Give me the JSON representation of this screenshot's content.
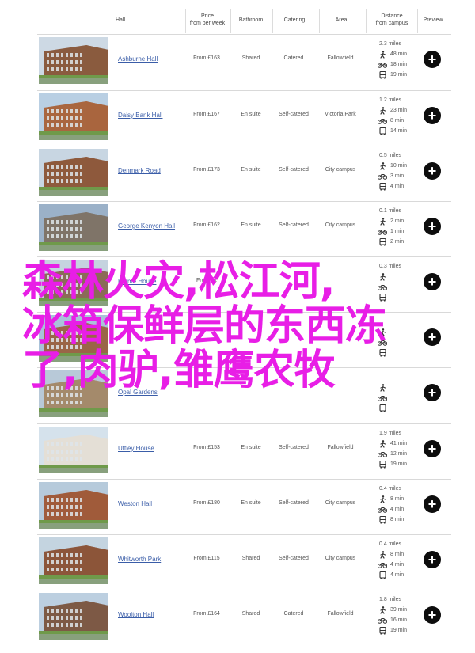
{
  "header": {
    "hall": "Hall",
    "price": "Price\nfrom per week",
    "bathroom": "Bathroom",
    "catering": "Catering",
    "area": "Area",
    "distance": "Distance\nfrom campus",
    "preview": "Preview"
  },
  "icons": {
    "walk": "walking-person-icon",
    "bike": "bicycle-icon",
    "bus": "bus-icon",
    "preview": "plus-circle-icon"
  },
  "rows": [
    {
      "name": "Ashburne Hall",
      "price": "From £163",
      "bathroom": "Shared",
      "catering": "Catered",
      "area": "Fallowfield",
      "miles": "2.3 miles",
      "walk": "48 min",
      "bike": "18 min",
      "bus": "19 min"
    },
    {
      "name": "Daisy Bank Hall",
      "price": "From £167",
      "bathroom": "En suite",
      "catering": "Self-catered",
      "area": "Victoria Park",
      "miles": "1.2 miles",
      "walk": "23 min",
      "bike": "8 min",
      "bus": "14 min"
    },
    {
      "name": "Denmark Road",
      "price": "From £173",
      "bathroom": "En suite",
      "catering": "Self-catered",
      "area": "City campus",
      "miles": "0.5 miles",
      "walk": "10 min",
      "bike": "3 min",
      "bus": "4 min"
    },
    {
      "name": "George Kenyon Hall",
      "price": "From £162",
      "bathroom": "En suite",
      "catering": "Self-catered",
      "area": "City campus",
      "miles": "0.1 miles",
      "walk": "2 min",
      "bike": "1 min",
      "bus": "2 min"
    },
    {
      "name": "Hulme House",
      "price": "From £1",
      "bathroom": "",
      "catering": "",
      "area": "",
      "miles": "0.3 miles",
      "walk": "",
      "bike": "",
      "bus": ""
    },
    {
      "name": "",
      "price": "",
      "bathroom": "",
      "catering": "",
      "area": "",
      "miles": "",
      "walk": "",
      "bike": "",
      "bus": ""
    },
    {
      "name": "Opal Gardens",
      "price": "",
      "bathroom": "",
      "catering": "",
      "area": "",
      "miles": "",
      "walk": "",
      "bike": "",
      "bus": ""
    },
    {
      "name": "Uttley House",
      "price": "From £153",
      "bathroom": "En suite",
      "catering": "Self-catered",
      "area": "Fallowfield",
      "miles": "1.9 miles",
      "walk": "41 min",
      "bike": "12 min",
      "bus": "19 min"
    },
    {
      "name": "Weston Hall",
      "price": "From £180",
      "bathroom": "En suite",
      "catering": "Self-catered",
      "area": "City campus",
      "miles": "0.4 miles",
      "walk": "8 min",
      "bike": "4 min",
      "bus": "8 min"
    },
    {
      "name": "Whitworth Park",
      "price": "From £115",
      "bathroom": "Shared",
      "catering": "Self-catered",
      "area": "City campus",
      "miles": "0.4 miles",
      "walk": "8 min",
      "bike": "4 min",
      "bus": "4 min"
    },
    {
      "name": "Woolton Hall",
      "price": "From £164",
      "bathroom": "Shared",
      "catering": "Catered",
      "area": "Fallowfield",
      "miles": "1.8 miles",
      "walk": "39 min",
      "bike": "16 min",
      "bus": "19 min"
    }
  ],
  "overlay": {
    "line1": "森林火灾,松江河,",
    "line2": "冰箱保鲜层的东西冻",
    "line3": "了,肉驴,雏鹰农牧"
  }
}
